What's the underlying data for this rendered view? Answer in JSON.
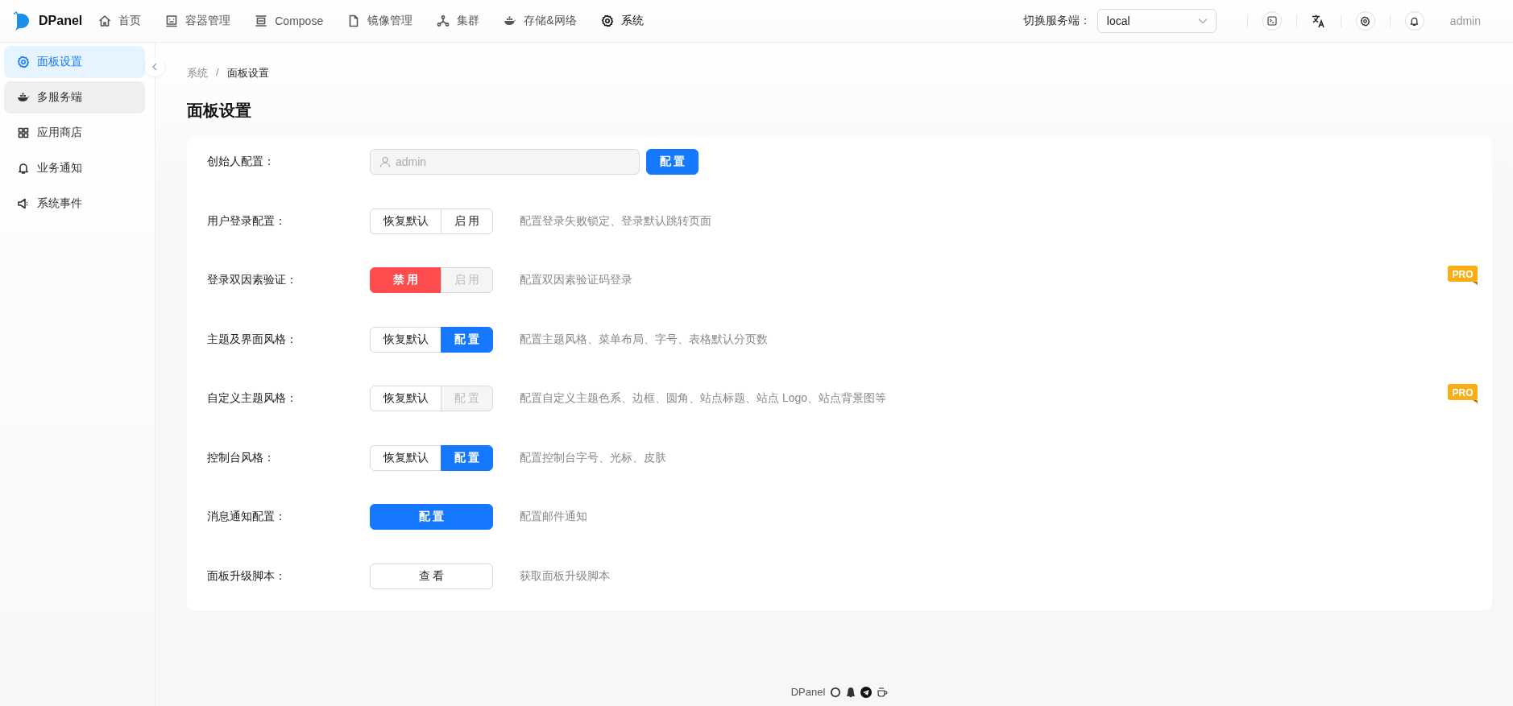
{
  "header": {
    "brand": "DPanel",
    "nav": [
      {
        "label": "首页",
        "selected": false
      },
      {
        "label": "容器管理",
        "selected": false
      },
      {
        "label": "Compose",
        "selected": false
      },
      {
        "label": "镜像管理",
        "selected": false
      },
      {
        "label": "集群",
        "selected": false
      },
      {
        "label": "存储&网络",
        "selected": false
      },
      {
        "label": "系统",
        "selected": true
      }
    ],
    "server_switch": {
      "label": "切换服务端：",
      "value": "local"
    },
    "user": "admin"
  },
  "sidebar": {
    "items": [
      {
        "label": "面板设置",
        "selected": true,
        "hovered": false
      },
      {
        "label": "多服务端",
        "selected": false,
        "hovered": true
      },
      {
        "label": "应用商店",
        "selected": false,
        "hovered": false
      },
      {
        "label": "业务通知",
        "selected": false,
        "hovered": false
      },
      {
        "label": "系统事件",
        "selected": false,
        "hovered": false
      }
    ]
  },
  "breadcrumb": {
    "items": [
      "系统",
      "面板设置"
    ],
    "separator": "/"
  },
  "page_title": "面板设置",
  "settings": [
    {
      "label": "创始人配置：",
      "kind": "input",
      "value": "admin",
      "disabled": true,
      "buttons": [
        {
          "label": "配 置",
          "kind": "primary"
        }
      ]
    },
    {
      "label": "用户登录配置：",
      "kind": "buttons",
      "buttons": [
        {
          "label": "恢复默认",
          "kind": "default"
        },
        {
          "label": "启 用",
          "kind": "default"
        }
      ],
      "description": "配置登录失败锁定、登录默认跳转页面"
    },
    {
      "label": "登录双因素验证：",
      "kind": "buttons",
      "buttons": [
        {
          "label": "禁 用",
          "kind": "danger"
        },
        {
          "label": "启 用",
          "kind": "disabled"
        }
      ],
      "description": "配置双因素验证码登录",
      "badge": "PRO"
    },
    {
      "label": "主题及界面风格：",
      "kind": "buttons",
      "buttons": [
        {
          "label": "恢复默认",
          "kind": "default"
        },
        {
          "label": "配 置",
          "kind": "primary"
        }
      ],
      "description": "配置主题风格、菜单布局、字号、表格默认分页数"
    },
    {
      "label": "自定义主题风格：",
      "kind": "buttons",
      "buttons": [
        {
          "label": "恢复默认",
          "kind": "default"
        },
        {
          "label": "配 置",
          "kind": "disabled"
        }
      ],
      "description": "配置自定义主题色系、边框、圆角、站点标题、站点 Logo、站点背景图等",
      "badge": "PRO"
    },
    {
      "label": "控制台风格：",
      "kind": "buttons",
      "buttons": [
        {
          "label": "恢复默认",
          "kind": "default"
        },
        {
          "label": "配 置",
          "kind": "primary"
        }
      ],
      "description": "配置控制台字号、光标、皮肤"
    },
    {
      "label": "消息通知配置：",
      "kind": "buttons",
      "buttons": [
        {
          "label": "配 置",
          "kind": "primary"
        }
      ],
      "description": "配置邮件通知"
    },
    {
      "label": "面板升级脚本：",
      "kind": "buttons",
      "buttons": [
        {
          "label": "查 看",
          "kind": "default"
        }
      ],
      "description": "获取面板升级脚本"
    }
  ],
  "footer": {
    "brand": "DPanel"
  }
}
